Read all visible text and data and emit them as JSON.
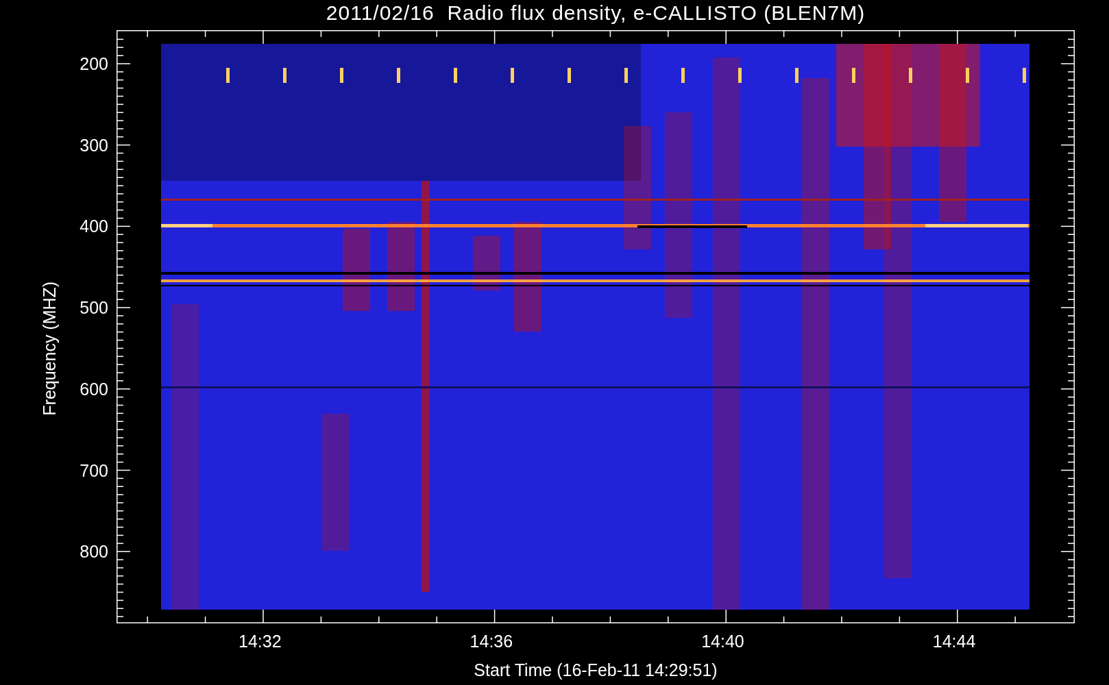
{
  "title": "2011/02/16  Radio flux density, e-CALLISTO (BLEN7M)",
  "y_axis": {
    "label": "Frequency (MHZ)",
    "ticks": [
      "200",
      "300",
      "400",
      "500",
      "600",
      "700",
      "800"
    ]
  },
  "x_axis": {
    "label": "Start Time (16-Feb-11 14:29:51)",
    "ticks": [
      "14:32",
      "14:36",
      "14:40",
      "14:44"
    ]
  }
}
